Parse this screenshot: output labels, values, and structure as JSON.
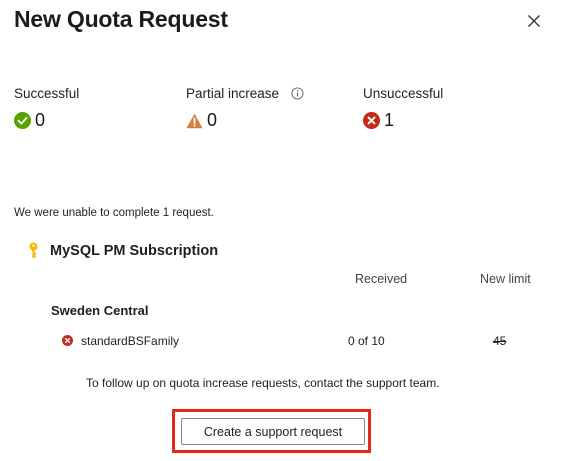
{
  "dialog": {
    "title": "New Quota Request",
    "close_icon": "close-icon"
  },
  "summary": {
    "successful": {
      "label": "Successful",
      "count": "0",
      "icon": "success-check-icon",
      "color": "#57a300"
    },
    "partial": {
      "label": "Partial increase",
      "count": "0",
      "icon": "warning-triangle-icon",
      "info_icon": "info-icon",
      "color": "#d67f3c"
    },
    "unsuccessful": {
      "label": "Unsuccessful",
      "count": "1",
      "icon": "error-x-icon",
      "color": "#c42b1c"
    }
  },
  "message": "We were unable to complete 1 request.",
  "subscription": {
    "name": "MySQL PM Subscription",
    "icon": "key-icon",
    "icon_color": "#f2b900"
  },
  "table": {
    "headers": {
      "received": "Received",
      "new_limit": "New limit"
    },
    "region": "Sweden Central",
    "rows": [
      {
        "family": "standardBSFamily",
        "received": "0 of 10",
        "new_limit": "45",
        "status_icon": "error-dot-icon"
      }
    ]
  },
  "followup_text": "To follow up on quota increase requests, contact the support team.",
  "support_button": {
    "label": "Create a support request",
    "highlight_color": "#e02b1b"
  }
}
